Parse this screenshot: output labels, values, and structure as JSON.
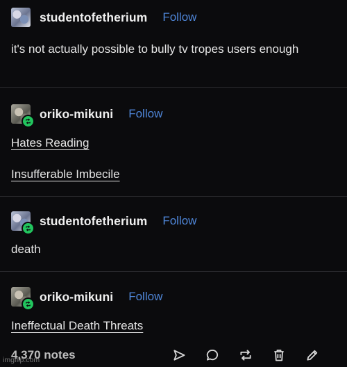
{
  "posts": [
    {
      "username": "studentofetherium",
      "follow_label": "Follow",
      "body": "it's not actually possible to bully tv tropes users enough",
      "avatar_icon": "avatar-anime-icon"
    },
    {
      "username": "oriko-mikuni",
      "follow_label": "Follow",
      "tags": [
        "Hates Reading",
        "Insufferable Imbecile"
      ],
      "avatar_icon": "avatar-anime-icon",
      "reblog_badge": true
    },
    {
      "username": "studentofetherium",
      "follow_label": "Follow",
      "body": "death",
      "avatar_icon": "avatar-anime-icon",
      "reblog_badge": true
    },
    {
      "username": "oriko-mikuni",
      "follow_label": "Follow",
      "tags": [
        "Ineffectual Death Threats"
      ],
      "avatar_icon": "avatar-anime-icon",
      "reblog_badge": true
    }
  ],
  "footer": {
    "notes": "4,370 notes",
    "actions": [
      "share-icon",
      "reply-icon",
      "reblog-icon",
      "delete-icon",
      "edit-icon"
    ]
  },
  "watermark": "imgflip.com",
  "colors": {
    "background": "#0b0b0d",
    "link": "#4f86d8",
    "reblog_badge": "#22c55e",
    "text": "#e6e6e6"
  }
}
